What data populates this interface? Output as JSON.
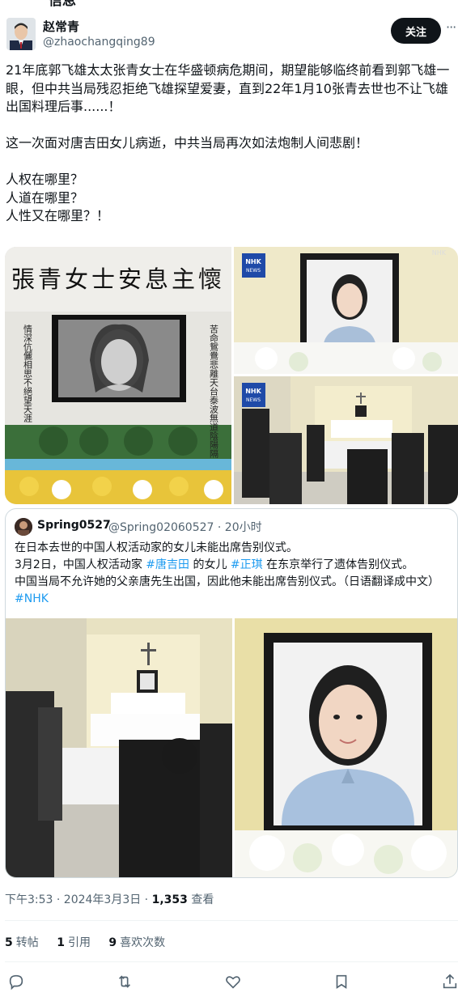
{
  "top_fragment": "信息",
  "author": {
    "name": "赵常青",
    "handle": "@zhaochangqing89",
    "follow_label": "关注",
    "more_label": "···"
  },
  "tweet": {
    "paragraphs": [
      "21年底郭飞雄太太张青女士在华盛顿病危期间，期望能够临终前看到郭飞雄一眼，但中共当局残忍拒绝飞雄探望爱妻，直到22年1月10张青去世也不让飞雄出国料理后事......！",
      "这一次面对唐吉田女儿病逝，中共当局再次如法炮制人间悲剧！",
      "人权在哪里？",
      "人道在哪里？",
      "人性又在哪里？！"
    ]
  },
  "media": {
    "memorial_banner": "張青女士安息主懷",
    "couplet_left": "情深伉儷相思不絕望天涯",
    "couplet_right": "苦命鴛鴦悲離天台泰波無道陰陽隔",
    "nhk_logo_line1": "NHK",
    "nhk_logo_line2": "NEWS",
    "nhk_watermark": "NHK"
  },
  "quote": {
    "name": "Spring0527",
    "handle_time": "@Spring02060527 · 20小时",
    "line1": "在日本去世的中国人权活动家的女儿未能出席告别仪式。",
    "line2_a": "3月2日，中国人权活动家 ",
    "tag1": "#唐吉田",
    "line2_b": " 的女儿 ",
    "tag2": "#正琪",
    "line2_c": " 在东京举行了遗体告别仪式。",
    "line3": "中国当局不允许她的父亲唐先生出国，因此他未能出席告别仪式。（日语翻译成中文）",
    "tag3": "#NHK"
  },
  "meta": {
    "time": "下午3:53 · 2024年3月3日 · ",
    "views_count": "1,353",
    "views_label": " 查看"
  },
  "stats": {
    "retweets_count": "5",
    "retweets_label": "转帖",
    "quotes_count": "1",
    "quotes_label": "引用",
    "likes_count": "9",
    "likes_label": "喜欢次数"
  },
  "colors": {
    "accent": "#1d9bf0",
    "text": "#0f1419",
    "muted": "#536471",
    "border": "#cfd9de"
  },
  "icons": [
    "reply-icon",
    "retweet-icon",
    "like-icon",
    "bookmark-icon",
    "share-icon",
    "more-icon"
  ]
}
